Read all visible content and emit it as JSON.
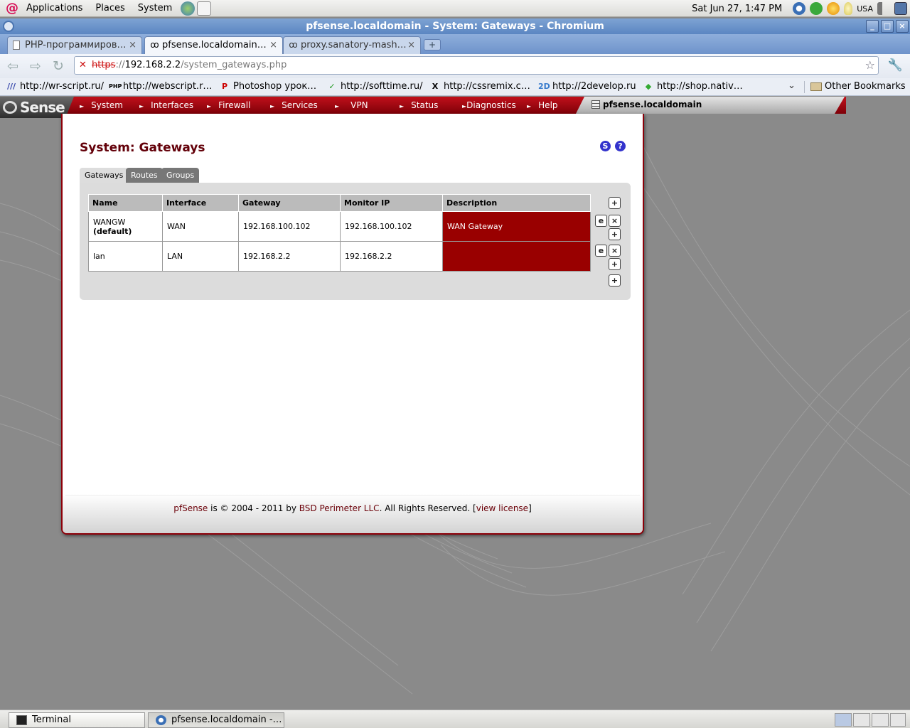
{
  "top_panel": {
    "menus": [
      "Applications",
      "Places",
      "System"
    ],
    "clock": "Sat Jun 27,  1:47 PM",
    "keyboard_layout": "USA"
  },
  "window": {
    "title": "pfsense.localdomain - System: Gateways - Chromium"
  },
  "tabs": [
    {
      "label": "PHP-программиров…",
      "active": false
    },
    {
      "label": "pfsense.localdomain…",
      "active": true
    },
    {
      "label": "proxy.sanatory-mash…",
      "active": false
    }
  ],
  "omnibox": {
    "protocol": "https",
    "separator": "://",
    "host": "192.168.2.2",
    "path": "/system_gateways.php"
  },
  "bookmarks": {
    "items": [
      "http://wr-script.ru/",
      "http://webscript.r…",
      "Photoshop урок…",
      "http://softtime.ru/",
      "http://cssremix.c…",
      "http://2develop.ru",
      "http://shop.nativ…"
    ],
    "other": "Other Bookmarks"
  },
  "pfsense": {
    "logo": "Sense",
    "menu": [
      "System",
      "Interfaces",
      "Firewall",
      "Services",
      "VPN",
      "Status",
      "Diagnostics",
      "Help"
    ],
    "hostname": "pfsense.localdomain",
    "page_title": "System: Gateways",
    "icons": {
      "status": "S",
      "help": "?"
    },
    "tabs": [
      "Gateways",
      "Routes",
      "Groups"
    ],
    "table": {
      "headers": [
        "Name",
        "Interface",
        "Gateway",
        "Monitor IP",
        "Description"
      ],
      "rows": [
        {
          "name": "WANGW",
          "tag": "(default)",
          "interface": "WAN",
          "gateway": "192.168.100.102",
          "monitor": "192.168.100.102",
          "description": "WAN Gateway"
        },
        {
          "name": "lan",
          "tag": "",
          "interface": "LAN",
          "gateway": "192.168.2.2",
          "monitor": "192.168.2.2",
          "description": ""
        }
      ]
    },
    "footer": {
      "brand": "pfSense",
      "text1": " is © 2004 - 2011 by ",
      "company": "BSD Perimeter LLC",
      "text2": ". All Rights Reserved. [",
      "license": "view license",
      "text3": "]"
    }
  },
  "taskbar": {
    "tasks": [
      "Terminal",
      "pfsense.localdomain -…"
    ]
  }
}
